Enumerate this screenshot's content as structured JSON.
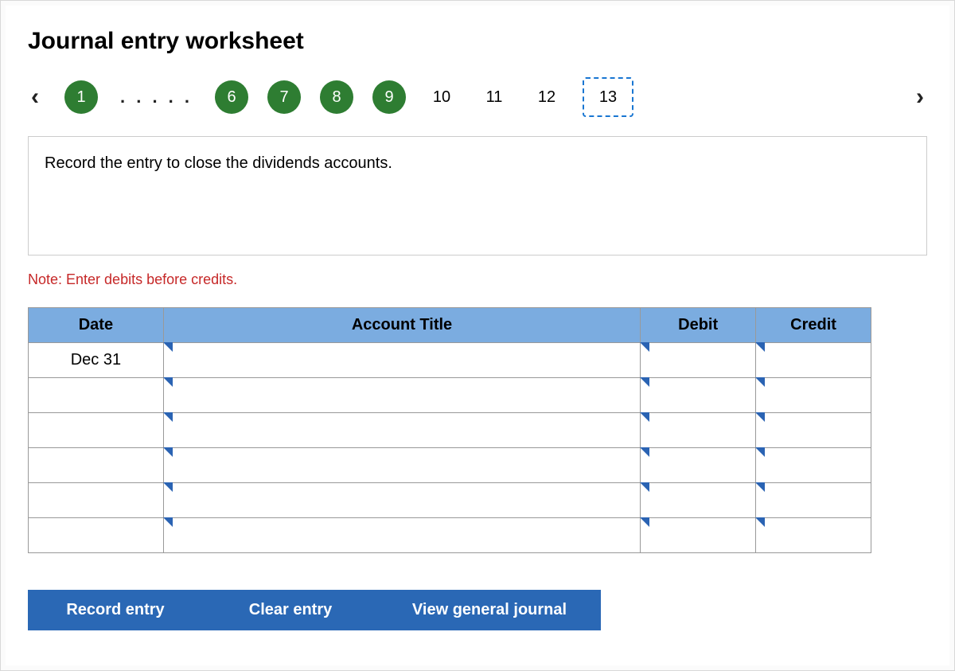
{
  "title": "Journal entry worksheet",
  "nav": {
    "prev_icon": "‹",
    "next_icon": "›",
    "ellipsis": ". . . . .",
    "steps": [
      {
        "label": "1",
        "state": "done"
      },
      {
        "label": "6",
        "state": "done"
      },
      {
        "label": "7",
        "state": "done"
      },
      {
        "label": "8",
        "state": "done"
      },
      {
        "label": "9",
        "state": "done"
      },
      {
        "label": "10",
        "state": "plain"
      },
      {
        "label": "11",
        "state": "plain"
      },
      {
        "label": "12",
        "state": "plain"
      },
      {
        "label": "13",
        "state": "current"
      }
    ]
  },
  "prompt": "Record the entry to close the dividends accounts.",
  "note": "Note: Enter debits before credits.",
  "table": {
    "headers": {
      "date": "Date",
      "account": "Account Title",
      "debit": "Debit",
      "credit": "Credit"
    },
    "rows": [
      {
        "date": "Dec 31",
        "account": "",
        "debit": "",
        "credit": ""
      },
      {
        "date": "",
        "account": "",
        "debit": "",
        "credit": ""
      },
      {
        "date": "",
        "account": "",
        "debit": "",
        "credit": ""
      },
      {
        "date": "",
        "account": "",
        "debit": "",
        "credit": ""
      },
      {
        "date": "",
        "account": "",
        "debit": "",
        "credit": ""
      },
      {
        "date": "",
        "account": "",
        "debit": "",
        "credit": ""
      }
    ]
  },
  "buttons": {
    "record": "Record entry",
    "clear": "Clear entry",
    "view": "View general journal"
  }
}
